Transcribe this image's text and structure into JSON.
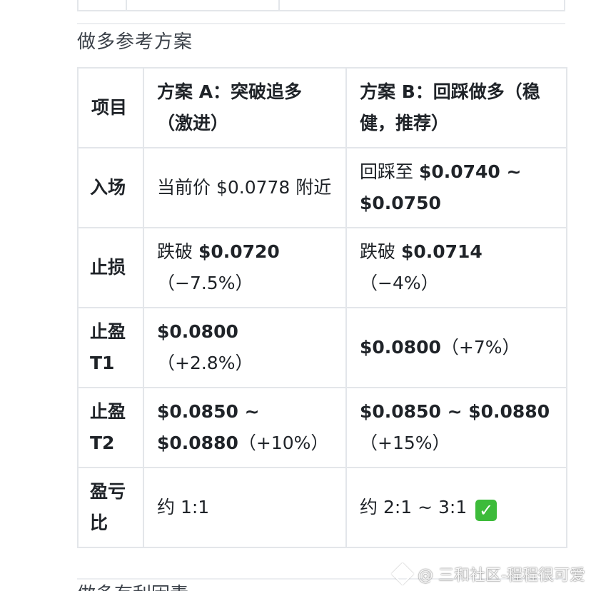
{
  "section_title": "做多参考方案",
  "next_section_title": "做多有利因素",
  "table": {
    "header": {
      "item": "项目",
      "plan_a": "方案 A：突破追多（激进）",
      "plan_b": "方案 B：回踩做多（稳健，推荐）"
    },
    "rows": [
      {
        "label": "入场",
        "a_prefix": "当前价 $0.0778 附近",
        "a_bold": "",
        "a_suffix": "",
        "b_prefix": "回踩至 ",
        "b_bold": "$0.0740 ~ $0.0750",
        "b_suffix": ""
      },
      {
        "label": "止损",
        "a_prefix": "跌破 ",
        "a_bold": "$0.0720",
        "a_suffix": "（−7.5%）",
        "b_prefix": "跌破 ",
        "b_bold": "$0.0714",
        "b_suffix": "（−4%）"
      },
      {
        "label": "止盈 T1",
        "a_prefix": "",
        "a_bold": "$0.0800",
        "a_suffix": "（+2.8%）",
        "b_prefix": "",
        "b_bold": "$0.0800",
        "b_suffix": "（+7%）"
      },
      {
        "label": "止盈 T2",
        "a_prefix": "",
        "a_bold": "$0.0850 ~ $0.0880",
        "a_suffix": "（+10%）",
        "b_prefix": "",
        "b_bold": "$0.0850 ~ $0.0880",
        "b_suffix": "（+15%）"
      },
      {
        "label": "盈亏比",
        "a_prefix": "约 1:1",
        "a_bold": "",
        "a_suffix": "",
        "b_prefix": "约 2:1 ~ 3:1",
        "b_bold": "",
        "b_suffix": "",
        "b_icon": "check-mark-icon"
      }
    ]
  },
  "watermark": "@ 三和社区-程程很可爱",
  "colors": {
    "border": "#e3e6ea",
    "check_green": "#3dbb3a"
  }
}
